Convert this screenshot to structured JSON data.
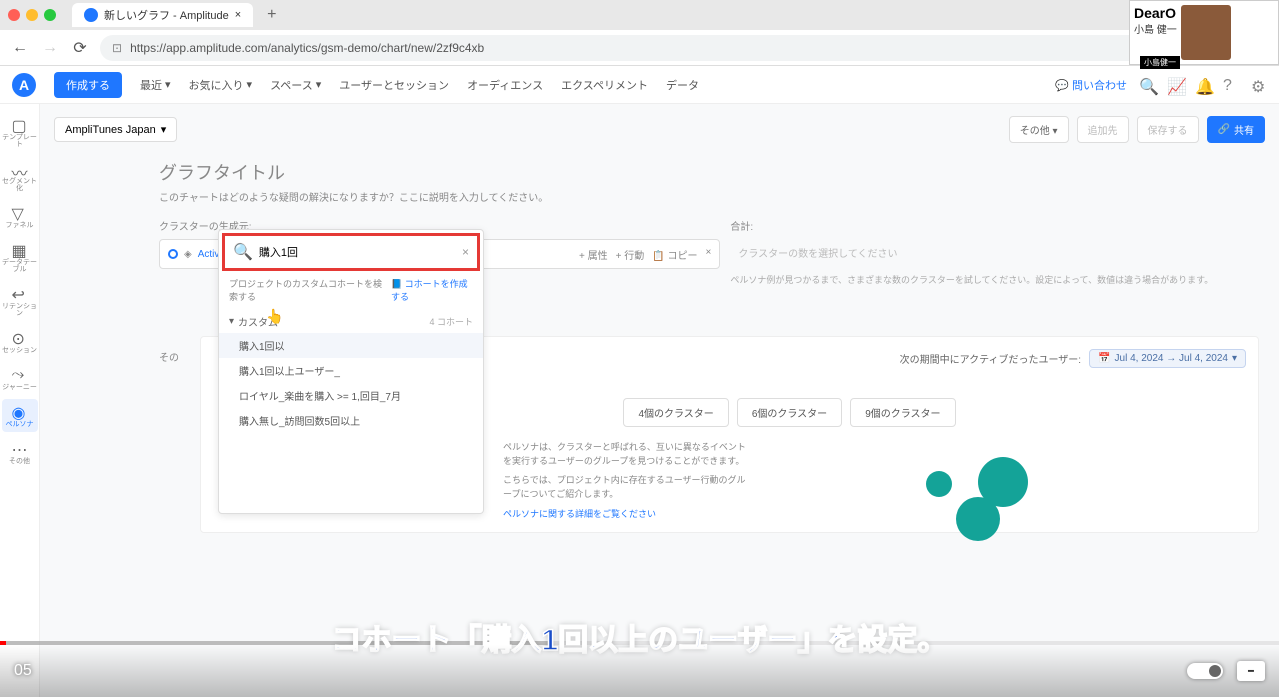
{
  "browser": {
    "tab_title": "新しいグラフ - Amplitude",
    "url": "https://app.amplitude.com/analytics/gsm-demo/chart/new/2zf9c4xb"
  },
  "overlay": {
    "brand": "DearO",
    "name": "小島 健一",
    "label": "小島健一"
  },
  "header": {
    "create": "作成する",
    "nav": [
      "最近",
      "お気に入り",
      "スペース",
      "ユーザーとセッション",
      "オーディエンス",
      "エクスペリメント",
      "データ"
    ],
    "help": "問い合わせ"
  },
  "sidebar": {
    "items": [
      {
        "label": "テンプレート"
      },
      {
        "label": "セグメント化"
      },
      {
        "label": "ファネル"
      },
      {
        "label": "データテーブル"
      },
      {
        "label": "リテンション"
      },
      {
        "label": "セッション"
      },
      {
        "label": "ジャーニー"
      },
      {
        "label": "ペルソナ"
      },
      {
        "label": "その他"
      }
    ]
  },
  "toolbar": {
    "project": "AmpliTunes Japan",
    "other": "その他",
    "add_to": "追加先",
    "save": "保存する",
    "share": "共有"
  },
  "page": {
    "title": "グラフタイトル",
    "subtitle": "このチャートはどのような疑問の解決になりますか？ここに説明を入力してください。"
  },
  "cluster": {
    "label": "クラスターの生成元:",
    "segment": "Active Users",
    "actions": {
      "attribute": "+ 属性",
      "action": "+ 行動",
      "copy": "コピー"
    },
    "other_segments": "その",
    "total_label": "合計:",
    "total_placeholder": "クラスターの数を選択してください",
    "help_text": "ペルソナ例が見つかるまで、さまざまな数のクラスターを試してください。設定によって、数値は違う場合があります。"
  },
  "dropdown": {
    "search_value": "購入1回",
    "hint_text": "プロジェクトのカスタムコホートを検索する",
    "hint_link": "コホートを作成する",
    "section": "カスタム",
    "count": "4 コホート",
    "items": [
      "購入1回以",
      "購入1回以上ユーザー_",
      "ロイヤル_楽曲を購入 >= 1,回目_7月",
      "購入無し_訪問回数5回以上"
    ]
  },
  "chart": {
    "date_prefix": "次の期間中にアクティブだったユーザー:",
    "date_range": "Jul 4, 2024 → Jul 4, 2024",
    "cluster_buttons": [
      "4個のクラスター",
      "6個のクラスター",
      "9個のクラスター"
    ],
    "desc1": "ペルソナは、クラスターと呼ばれる、互いに異なるイベントを実行するユーザーのグループを見つけることができます。",
    "desc2": "こちらでは、プロジェクト内に存在するユーザー行動のグループについてご紹介します。",
    "link": "ペルソナに関する詳細をご覧ください"
  },
  "video": {
    "time": "05",
    "subtitle": "コホート「購入1回以上のユーザー」を設定。"
  }
}
